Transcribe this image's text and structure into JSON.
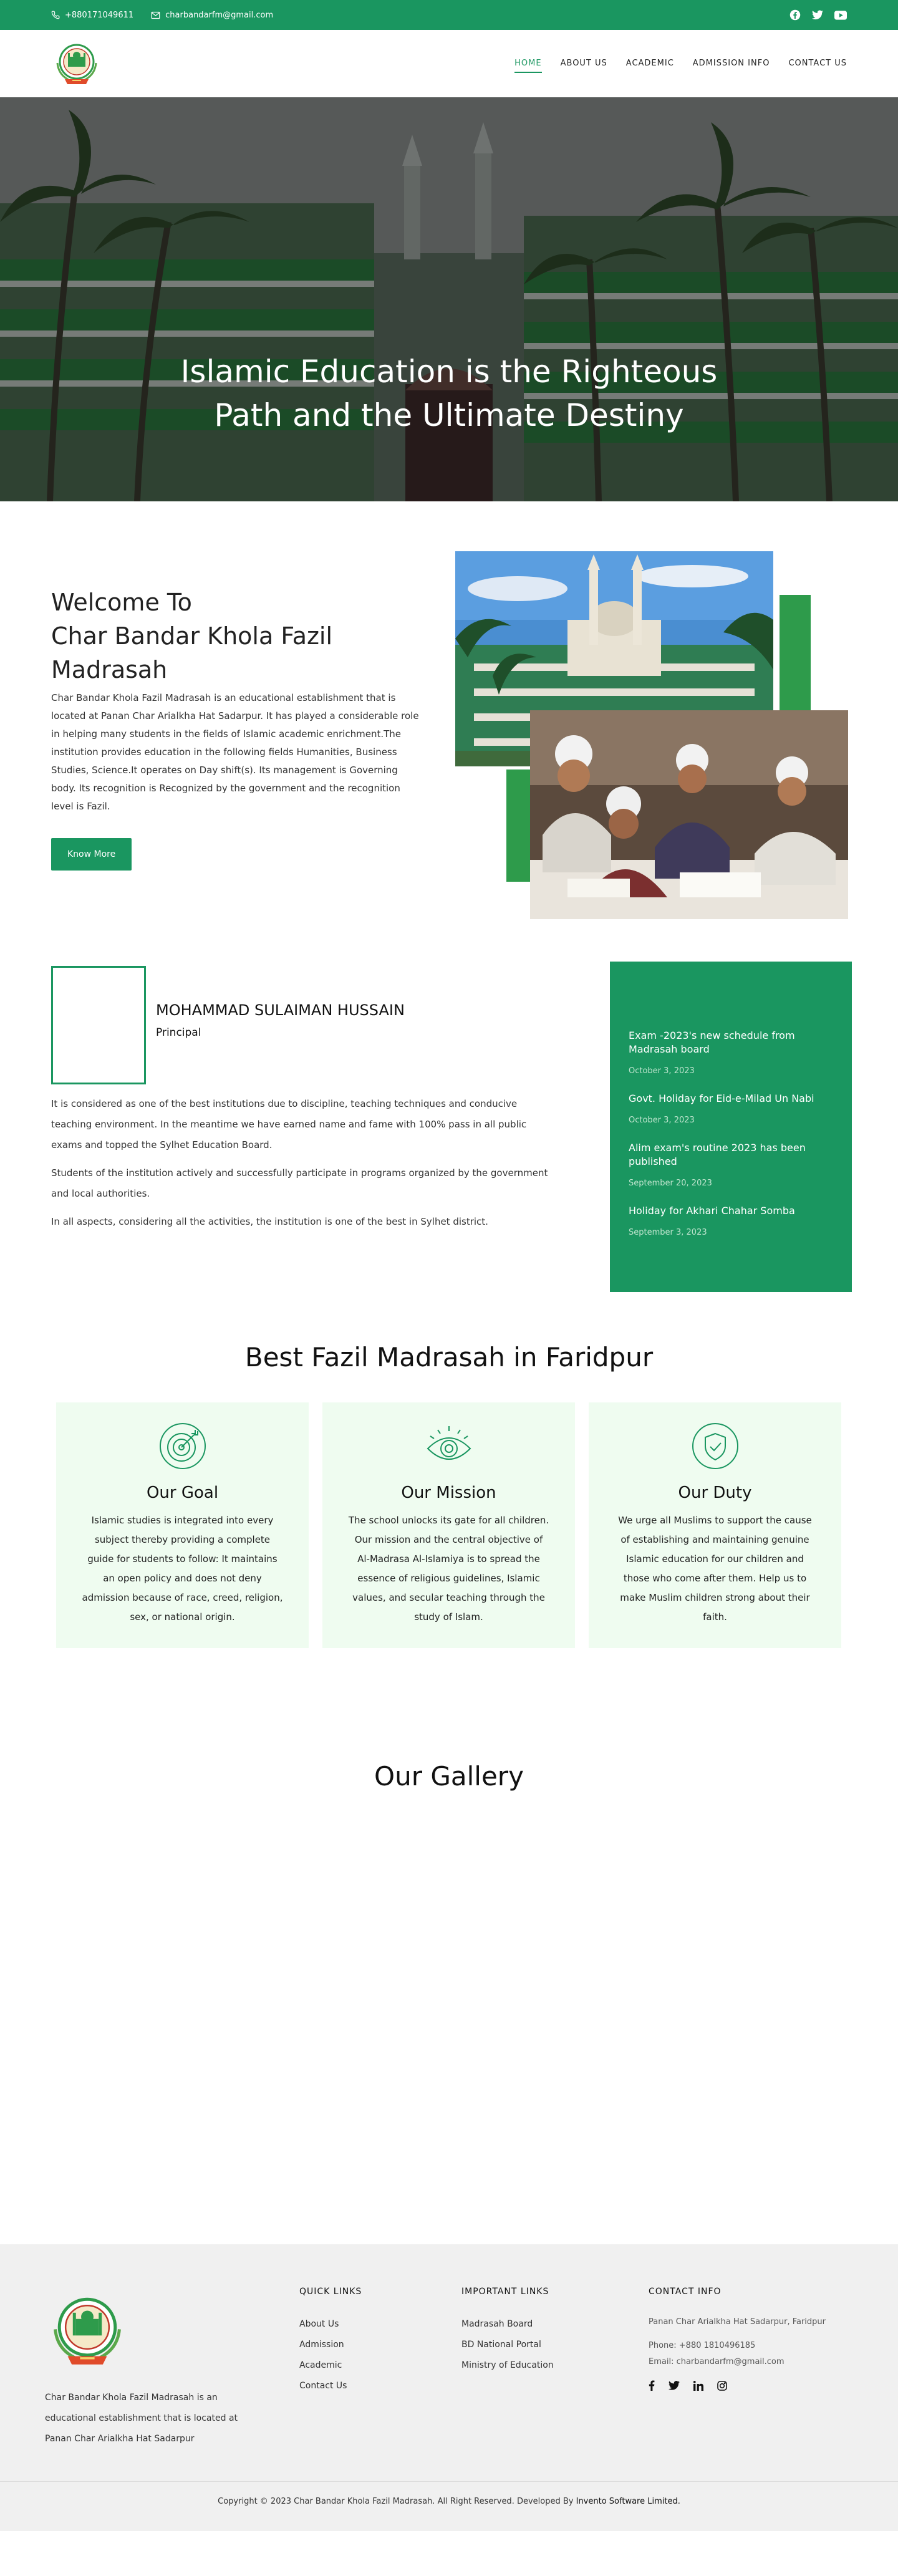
{
  "topbar": {
    "phone": "+880171049611",
    "email": "charbandarfm@gmail.com",
    "social": [
      "facebook-icon",
      "twitter-icon",
      "youtube-icon"
    ]
  },
  "nav": {
    "items": [
      "HOME",
      "ABOUT US",
      "ACADEMIC",
      "ADMISSION INFO",
      "CONTACT US"
    ],
    "active": "HOME"
  },
  "hero": {
    "line1": "Islamic Education is the Righteous",
    "line2": "Path and the Ultimate Destiny"
  },
  "welcome": {
    "title1": "Welcome To",
    "title2": "Char Bandar Khola Fazil Madrasah",
    "body": "Char Bandar Khola Fazil Madrasah is an educational establishment that is located at Panan Char Arialkha Hat Sadarpur. It has played a considerable role in helping many students in the fields of Islamic academic enrichment.The institution provides education in the following fields Humanities, Business Studies, Science.It operates on Day shift(s). Its management is Governing body. Its recognition is Recognized by the government and the recognition level is Fazil.",
    "button": "Know More"
  },
  "principal": {
    "name": "MOHAMMAD SULAIMAN HUSSAIN",
    "role": "Principal",
    "p1": "It is considered as one of the best institutions due to discipline, teaching techniques and conducive teaching environment. In the meantime we have earned name and fame with 100% pass in all public exams and topped the Sylhet Education Board.",
    "p2": "Students of the institution actively and successfully participate in programs organized by the government and local authorities.",
    "p3": "In all aspects, considering all the activities, the institution is one of the best in Sylhet district."
  },
  "notices": [
    {
      "title": "Exam -2023's new schedule from Madrasah board",
      "date": "October 3, 2023"
    },
    {
      "title": "Govt. Holiday for Eid-e-Milad Un Nabi",
      "date": "October 3, 2023"
    },
    {
      "title": "Alim exam's routine 2023 has been published",
      "date": "September 20, 2023"
    },
    {
      "title": "Holiday for Akhari Chahar Somba",
      "date": "September 3, 2023"
    }
  ],
  "features": {
    "title": "Best Fazil Madrasah in Faridpur",
    "cards": [
      {
        "icon": "target-icon",
        "title": "Our Goal",
        "text": "Islamic studies is integrated into every subject thereby providing a complete guide for students to follow: It maintains an open policy and does not deny admission because of race, creed, religion, sex, or national origin."
      },
      {
        "icon": "eye-icon",
        "title": "Our Mission",
        "text": "The school unlocks its gate for all children. Our mission and the central objective of Al-Madrasa Al-Islamiya is to spread the essence of religious guidelines, Islamic values, and secular teaching through the study of Islam."
      },
      {
        "icon": "shield-check-icon",
        "title": "Our Duty",
        "text": "We urge all Muslims to support the cause of establishing and maintaining genuine Islamic education for our children and those who come after them. Help us to make Muslim children strong about their faith."
      }
    ]
  },
  "gallery": {
    "title": "Our Gallery"
  },
  "footer": {
    "about": "Char Bandar Khola Fazil Madrasah is an educational establishment that is located at Panan Char Arialkha Hat Sadarpur",
    "quick_title": "QUICK  LINKS",
    "quick_links": [
      "About Us",
      "Admission",
      "Academic",
      "Contact Us"
    ],
    "important_title": "IMPORTANT  LINKS",
    "important_links": [
      "Madrasah Board",
      "BD National Portal",
      "Ministry of Education"
    ],
    "contact_title": "CONTACT  INFO",
    "address": "Panan Char Arialkha Hat Sadarpur, Faridpur",
    "phone": "Phone: +880 1810496185",
    "email": "Email: charbandarfm@gmail.com",
    "social": [
      "facebook-icon",
      "twitter-icon",
      "linkedin-icon",
      "instagram-icon"
    ],
    "copyright": "Copyright © 2023 Char Bandar Khola Fazil Madrasah. All Right Reserved. Developed By",
    "developer": "Invento Software Limited."
  }
}
